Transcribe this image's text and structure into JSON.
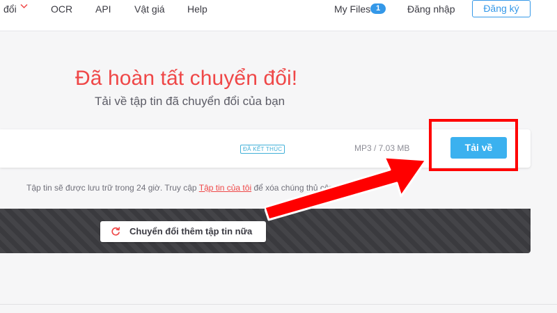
{
  "nav": {
    "convert_label": "đổi",
    "ocr_label": "OCR",
    "api_label": "API",
    "pricing_label": "Vật giá",
    "help_label": "Help",
    "my_files_label": "My Files",
    "my_files_count": "1",
    "login_label": "Đăng nhập",
    "signup_label": "Đăng ký"
  },
  "main": {
    "heading": "Đã hoàn tất chuyển đổi!",
    "subheading": "Tải về tập tin đã chuyển đổi của bạn"
  },
  "file": {
    "status": "ĐÃ KẾT THÚC",
    "format_size": "MP3 / 7.03 MB",
    "download_label": "Tải về"
  },
  "note": {
    "before": "Tập tin sẽ được lưu trữ trong 24 giờ. Truy cập ",
    "link": "Tập tin của tôi",
    "after": " để xóa chúng thủ công."
  },
  "actions": {
    "convert_more_label": "Chuyển đổi thêm tập tin nữa"
  },
  "colors": {
    "accent_red": "#ef4747",
    "accent_blue": "#3bb1ef",
    "annotation_red": "#ff0000"
  }
}
